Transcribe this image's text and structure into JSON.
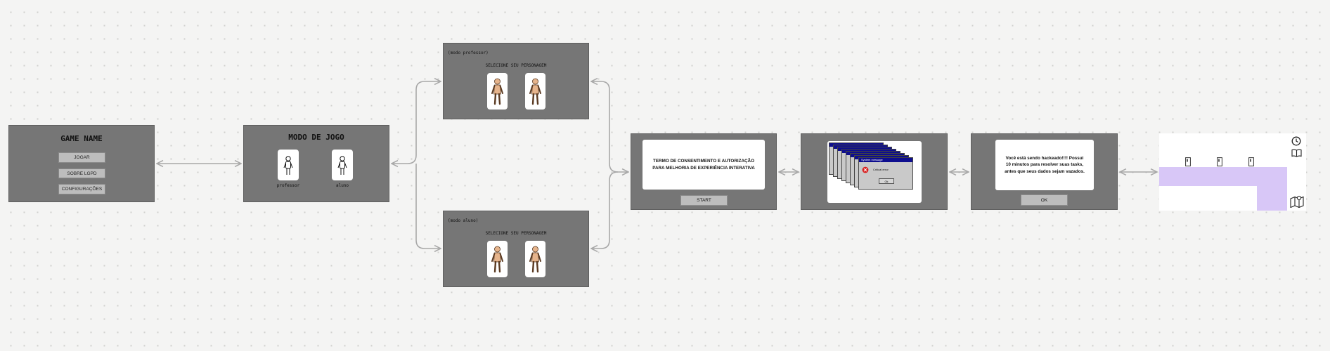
{
  "menu": {
    "title": "GAME NAME",
    "buttons": [
      "JOGAR",
      "SOBRE LGPD",
      "CONFIGURAÇÕES"
    ]
  },
  "mode_select": {
    "title": "MODO DE JOGO",
    "options": [
      "professor",
      "aluno"
    ]
  },
  "teacher_mode": {
    "label": "(modo professor)",
    "subtitle": "SELECIONE SEU PERSONAGEM"
  },
  "student_mode": {
    "label": "(modo aluno)",
    "subtitle": "SELECIONE SEU PERSONAGEM"
  },
  "consent": {
    "text": "TERMO DE CONSENTIMENTO E AUTORIZAÇÃO PARA MELHORIA DE EXPERIÊNCIA INTERATIVA",
    "button": "START"
  },
  "popups": {
    "bar_title": "System message",
    "message": "Critical error",
    "button": "Ok"
  },
  "hacked": {
    "text": "Você está sendo hackeado!!!! Possui 10 minutos para resolver suas tasks, antes que seus dados sejam vazados.",
    "button": "OK"
  },
  "level_map": {
    "icons": [
      "clock-icon",
      "book-icon",
      "map-icon",
      "door-icon"
    ],
    "corridor_color": "#d8c7f7"
  },
  "colors": {
    "canvas": "#f4f4f3",
    "frame": "#767676",
    "button": "#bdbdbd",
    "arrow": "#a8a8a8"
  }
}
